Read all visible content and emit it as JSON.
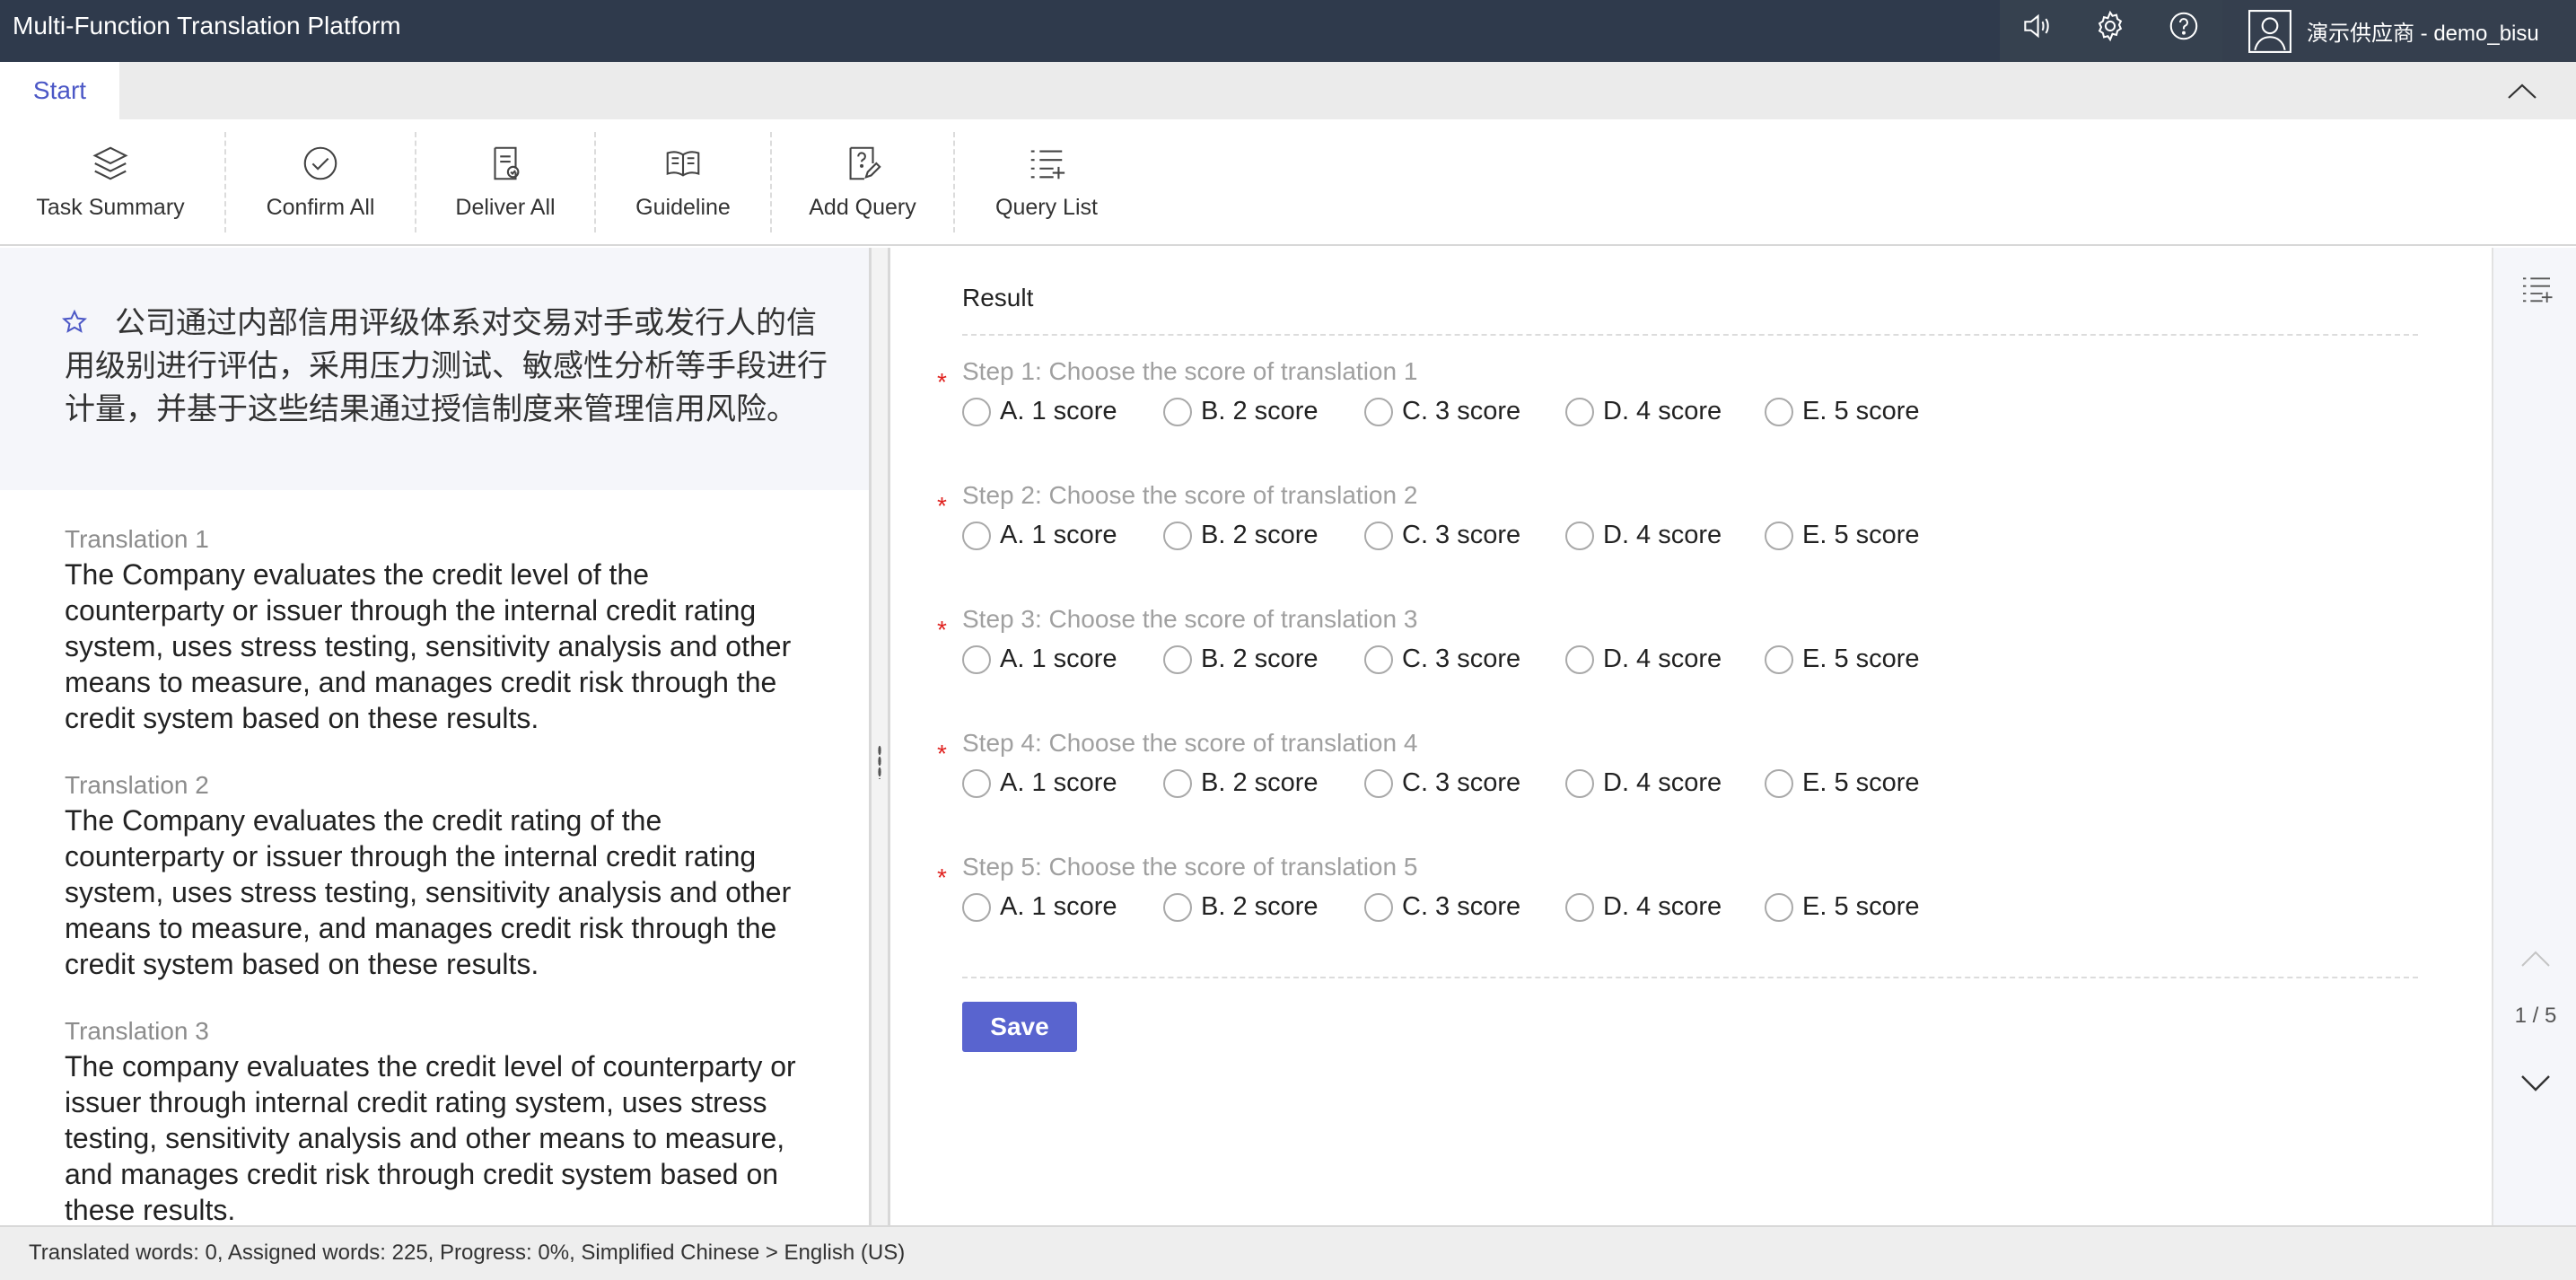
{
  "app": {
    "title": "Multi-Function Translation Platform"
  },
  "header": {
    "icons": [
      "speaker-icon",
      "gear-icon",
      "help-icon"
    ],
    "user_name": "演示供应商 - demo_bisu"
  },
  "tabs": [
    {
      "label": "Start",
      "active": true
    }
  ],
  "toolbar": {
    "items": [
      {
        "label": "Task Summary",
        "icon": "layers-icon"
      },
      {
        "label": "Confirm All",
        "icon": "check-circle-icon"
      },
      {
        "label": "Deliver All",
        "icon": "deliver-doc-icon"
      },
      {
        "label": "Guideline",
        "icon": "book-icon"
      },
      {
        "label": "Add Query",
        "icon": "add-query-icon"
      },
      {
        "label": "Query List",
        "icon": "query-list-icon"
      }
    ]
  },
  "source": {
    "text": "公司通过内部信用评级体系对交易对手或发行人的信用级别进行评估，采用压力测试、敏感性分析等手段进行计量，并基于这些结果通过授信制度来管理信用风险。"
  },
  "translations": [
    {
      "label": "Translation 1",
      "text": "The Company evaluates the credit level of the counterparty or issuer through the internal credit rating system, uses stress testing, sensitivity analysis and other means to measure, and manages credit risk through the credit system based on these results."
    },
    {
      "label": "Translation 2",
      "text": "The Company evaluates the credit rating of the counterparty or issuer through the internal credit rating system, uses stress testing, sensitivity analysis and other means to measure, and manages credit risk through the credit system based on these results."
    },
    {
      "label": "Translation 3",
      "text": "The company evaluates the credit level of counterparty or issuer through internal credit rating system, uses stress testing, sensitivity analysis and other means to measure, and manages credit risk through credit system based on these results."
    }
  ],
  "result": {
    "title": "Result",
    "steps": [
      {
        "label": "Step 1:  Choose the score of translation 1"
      },
      {
        "label": "Step 2:  Choose the score of translation 2"
      },
      {
        "label": "Step 3:  Choose the score of translation 3"
      },
      {
        "label": "Step 4:  Choose the score of translation 4"
      },
      {
        "label": "Step 5:  Choose the score of translation 5"
      }
    ],
    "options": [
      "A. 1 score",
      "B. 2 score",
      "C. 3 score",
      "D. 4 score",
      "E. 5 score"
    ],
    "save_label": "Save"
  },
  "pager": {
    "text": "1 / 5"
  },
  "status": {
    "text": "Translated words: 0, Assigned words: 225, Progress: 0%, Simplified Chinese > English (US)"
  },
  "colors": {
    "header_bg": "#2f3a4c",
    "accent": "#5964cf",
    "tab_active": "#4b57c6",
    "required": "#e0221f"
  }
}
